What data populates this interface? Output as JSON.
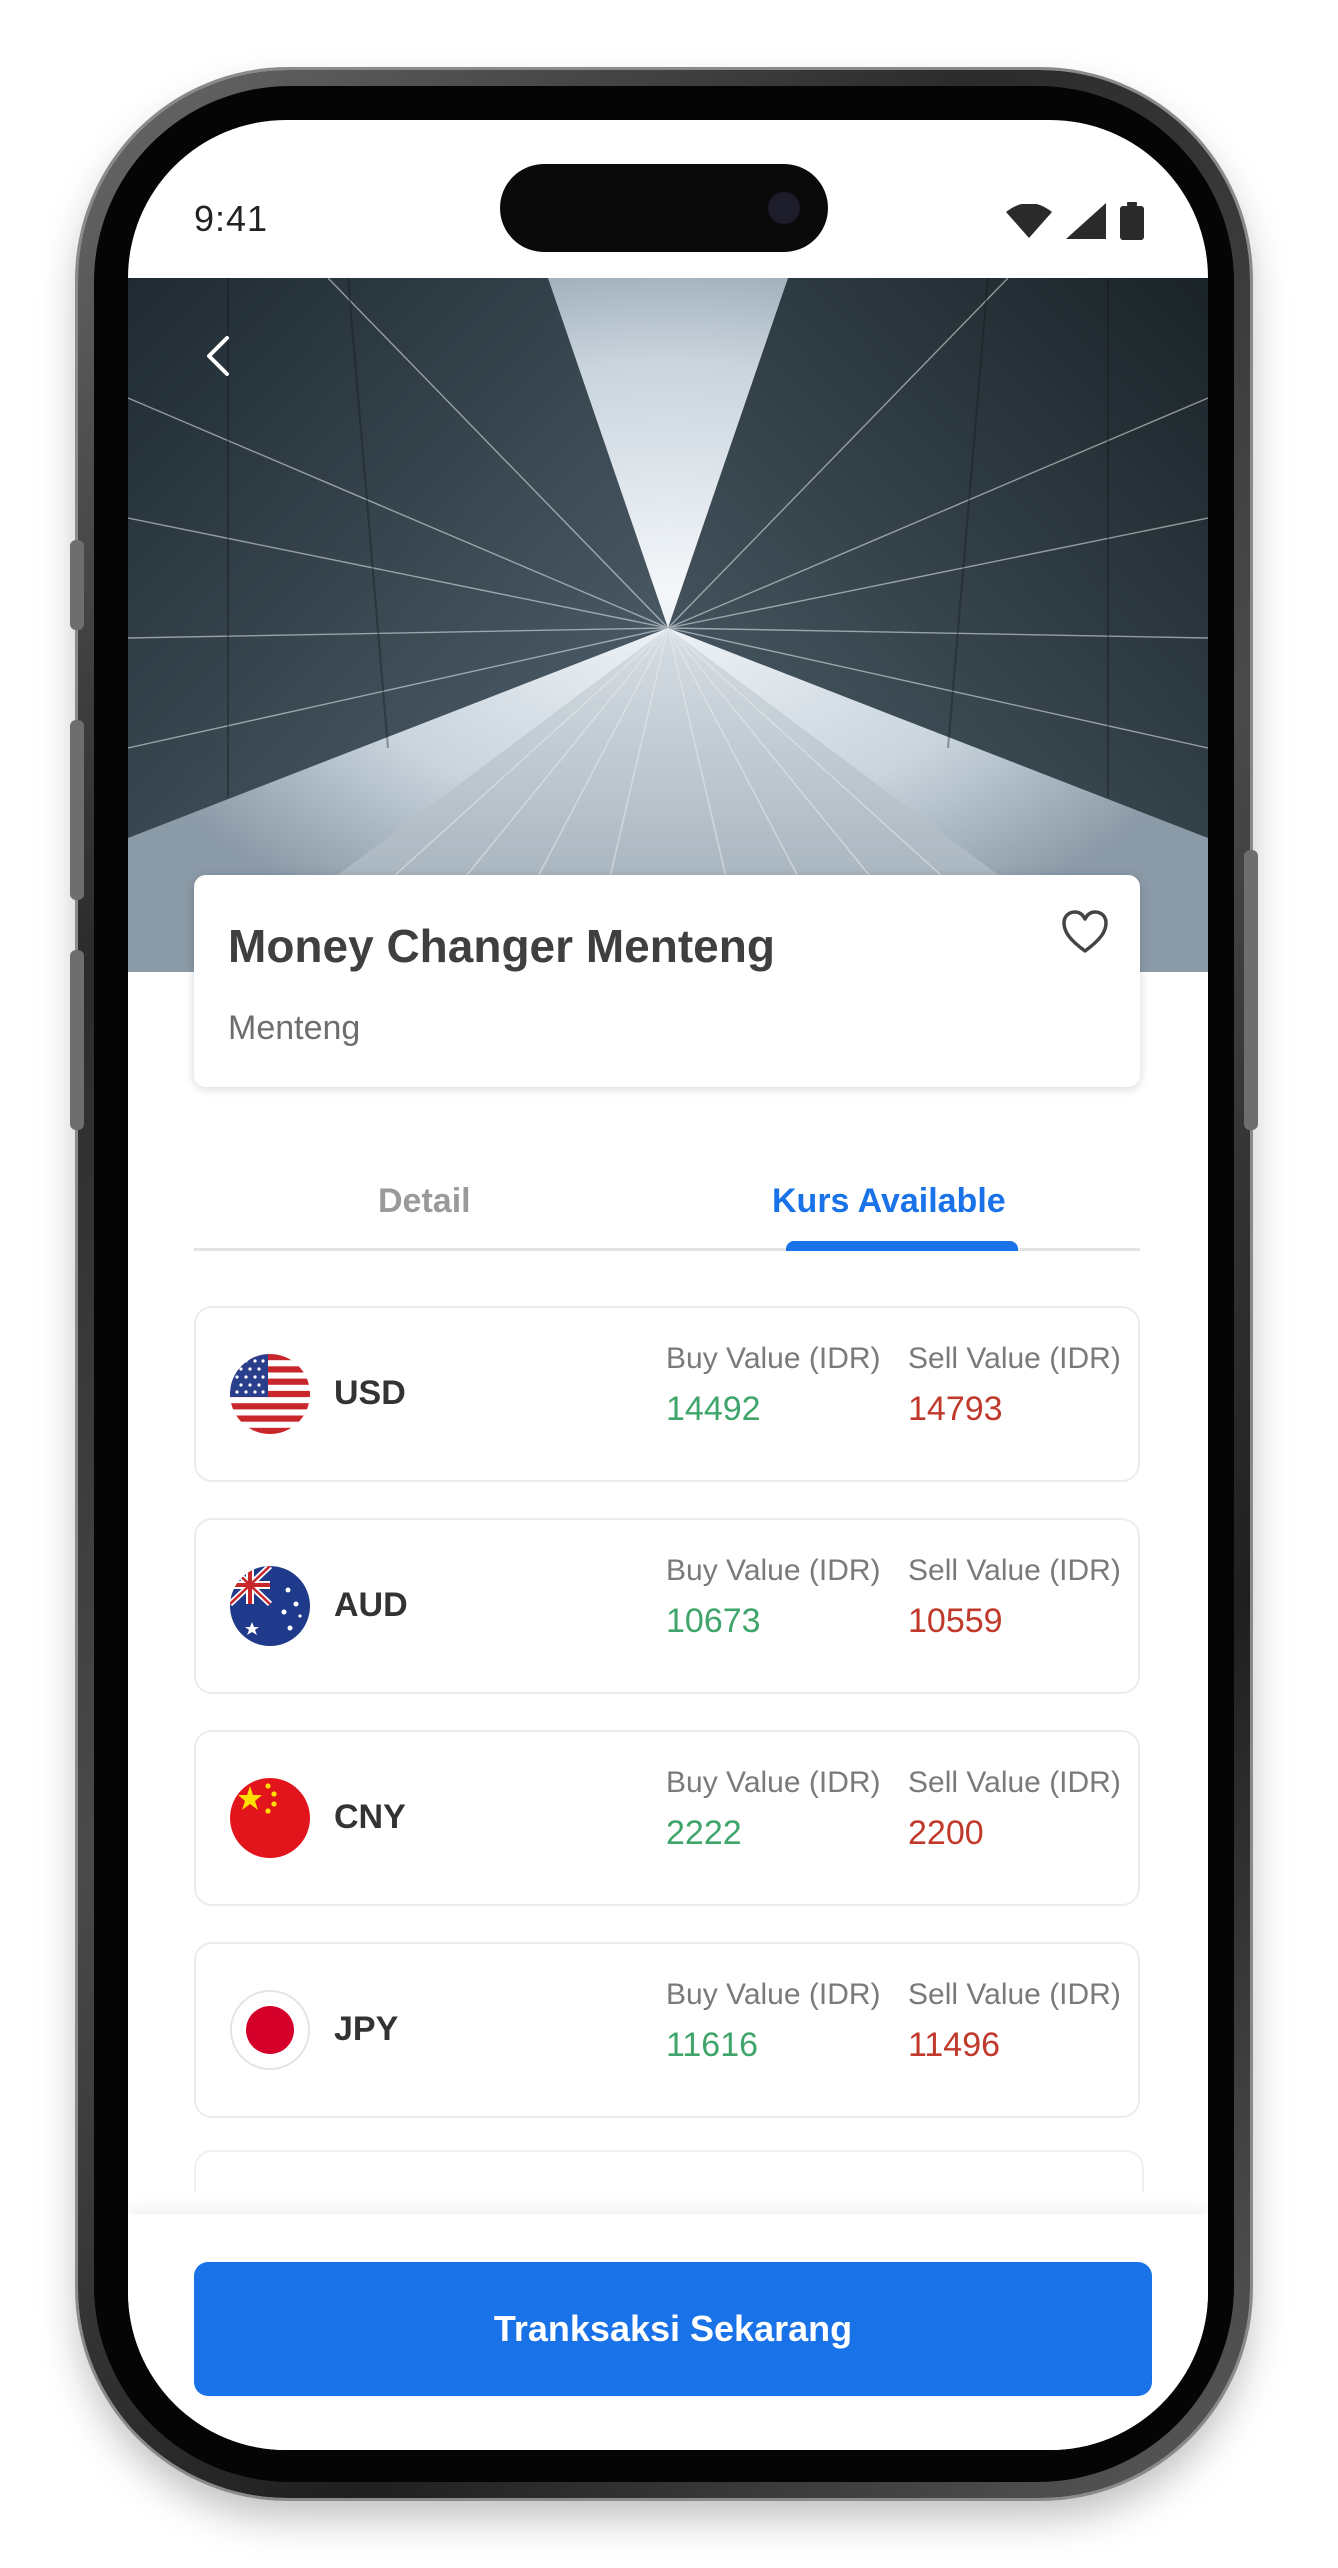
{
  "status_bar": {
    "time": "9:41",
    "icons": [
      "wifi-icon",
      "signal-icon",
      "battery-icon"
    ]
  },
  "header": {
    "back_icon": "chevron-left-icon"
  },
  "place": {
    "name": "Money Changer Menteng",
    "location": "Menteng",
    "favorite_icon": "heart-outline-icon"
  },
  "tabs": [
    {
      "label": "Detail",
      "active": false
    },
    {
      "label": "Kurs Available",
      "active": true
    }
  ],
  "rates": [
    {
      "code": "USD",
      "flag": "us-flag-icon",
      "buy_label": "Buy Value (IDR)",
      "buy": "14492",
      "sell_label": "Sell Value (IDR)",
      "sell": "14793"
    },
    {
      "code": "AUD",
      "flag": "au-flag-icon",
      "buy_label": "Buy Value (IDR)",
      "buy": "10673",
      "sell_label": "Sell Value (IDR)",
      "sell": "10559"
    },
    {
      "code": "CNY",
      "flag": "cn-flag-icon",
      "buy_label": "Buy Value (IDR)",
      "buy": "2222",
      "sell_label": "Sell Value (IDR)",
      "sell": "2200"
    },
    {
      "code": "JPY",
      "flag": "jp-flag-icon",
      "buy_label": "Buy Value (IDR)",
      "buy": "11616",
      "sell_label": "Sell Value (IDR)",
      "sell": "11496"
    }
  ],
  "cta": {
    "label": "Tranksaksi Sekarang"
  },
  "colors": {
    "accent": "#1a72e8",
    "buy": "#3fa56b",
    "sell": "#c0392b"
  }
}
